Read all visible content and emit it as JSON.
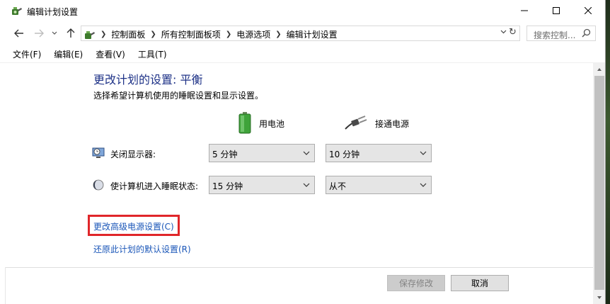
{
  "window": {
    "title": "编辑计划设置"
  },
  "nav": {
    "breadcrumbs": [
      "控制面板",
      "所有控制面板项",
      "电源选项",
      "编辑计划设置"
    ],
    "search_placeholder": "搜索控制..."
  },
  "menu": {
    "items": [
      "文件(F)",
      "编辑(E)",
      "查看(V)",
      "工具(T)"
    ]
  },
  "main": {
    "heading": "更改计划的设置: 平衡",
    "subtitle": "选择希望计算机使用的睡眠设置和显示设置。",
    "columns": {
      "battery": "用电池",
      "plugged": "接通电源"
    },
    "settings": [
      {
        "label": "关闭显示器:",
        "battery": "5 分钟",
        "plugged": "10 分钟"
      },
      {
        "label": "使计算机进入睡眠状态:",
        "battery": "15 分钟",
        "plugged": "从不"
      }
    ],
    "links": {
      "advanced": "更改高级电源设置(C)",
      "restore": "还原此计划的默认设置(R)"
    }
  },
  "buttons": {
    "save": "保存修改",
    "cancel": "取消"
  },
  "colors": {
    "heading": "#1e3287",
    "link": "#1a56b8",
    "highlight_box": "#e0262a"
  },
  "icons": {
    "app": "power-options-icon",
    "back": "arrow-left-icon",
    "forward": "arrow-right-icon",
    "recent": "chevron-down-icon",
    "up": "arrow-up-icon",
    "refresh": "refresh-icon",
    "search": "search-icon",
    "battery": "battery-icon",
    "plug": "plug-icon",
    "display": "monitor-clock-icon",
    "sleep": "moon-icon"
  }
}
